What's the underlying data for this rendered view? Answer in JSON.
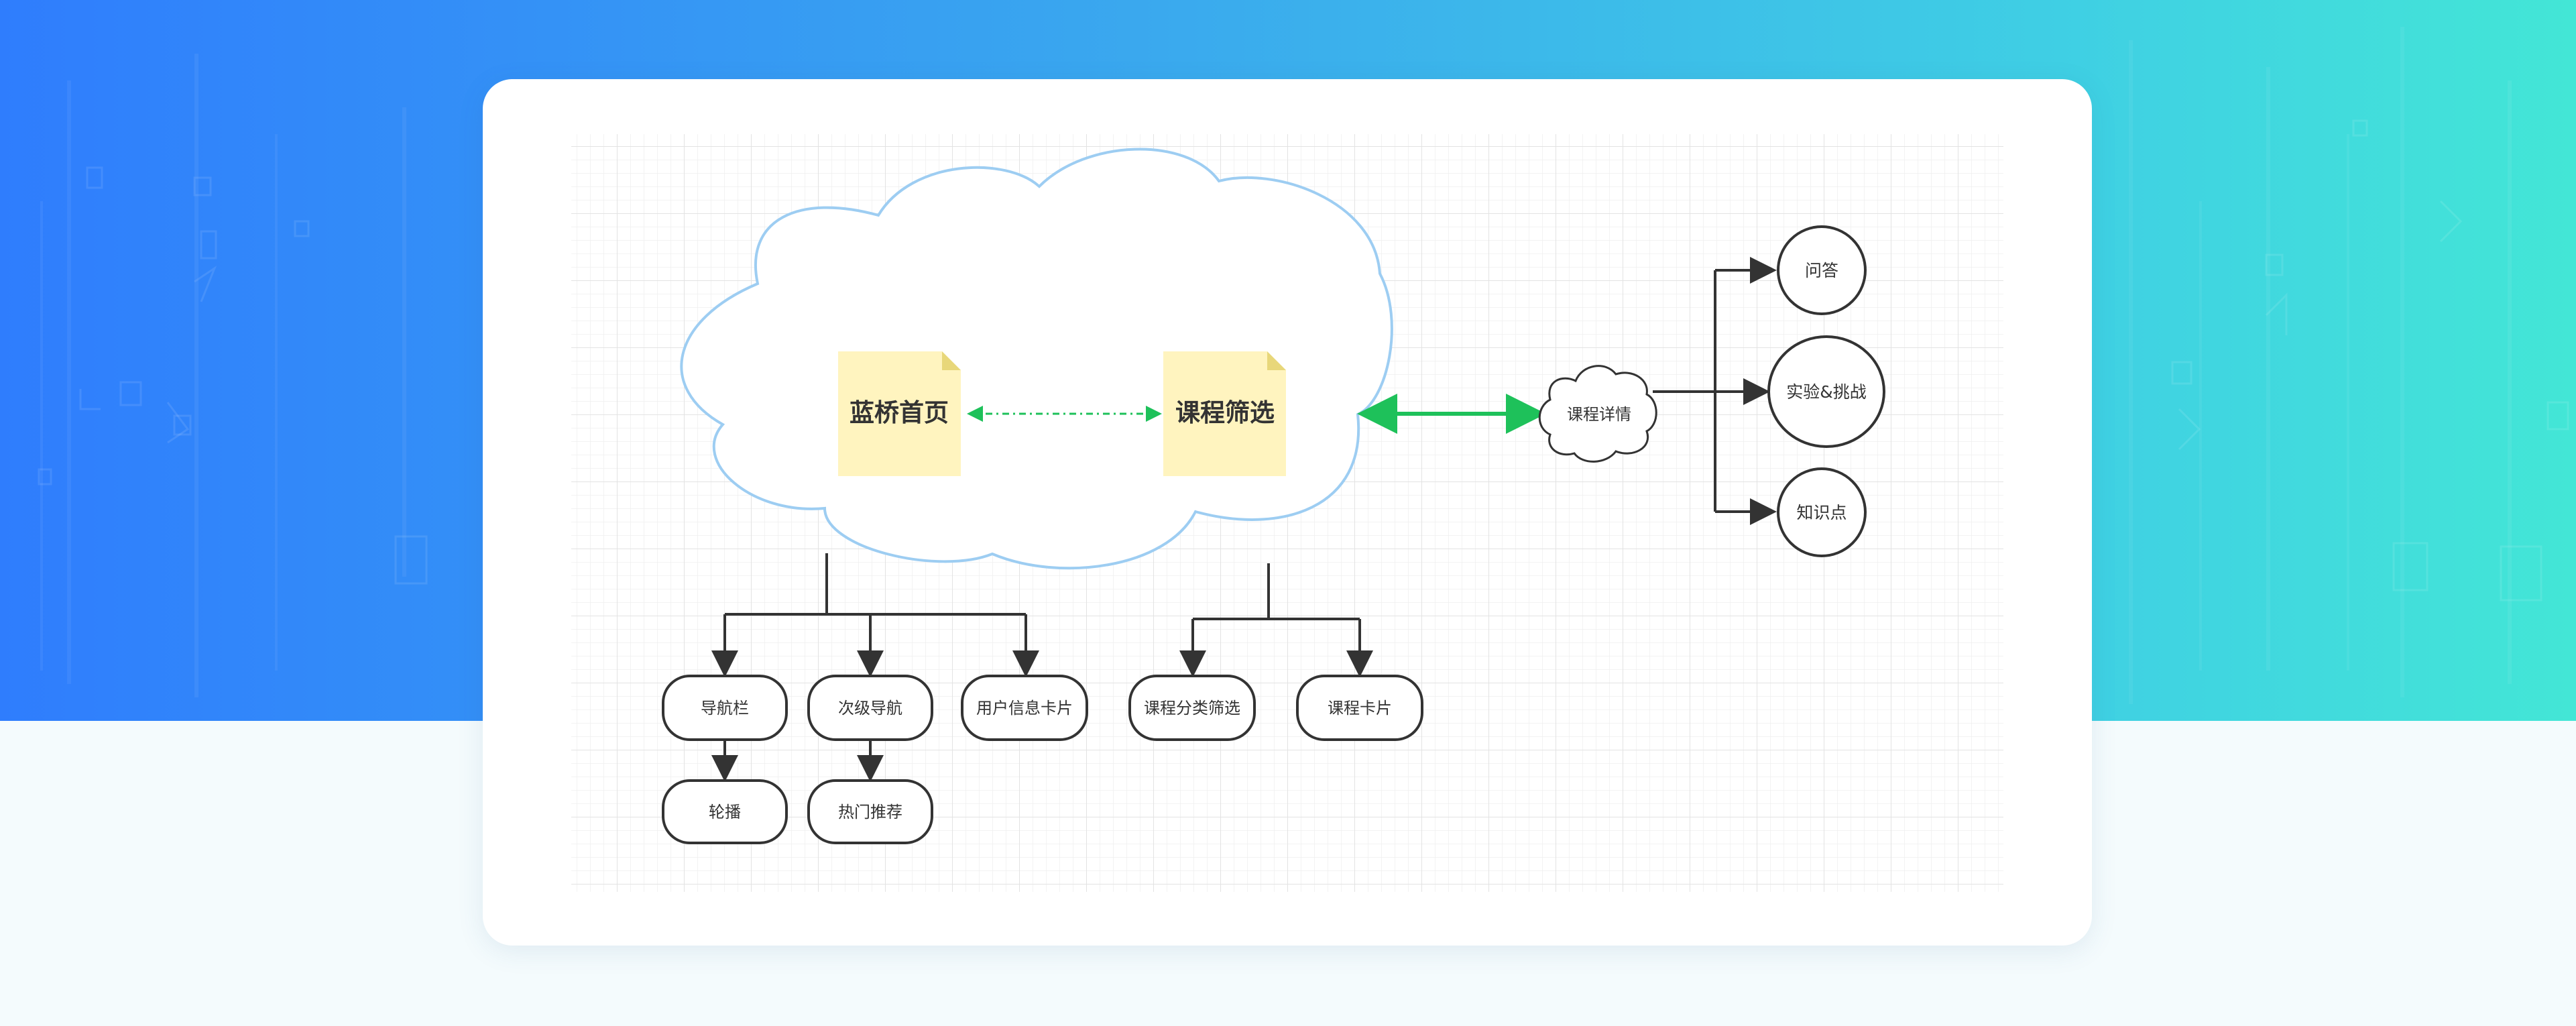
{
  "diagram": {
    "cloud_nodes": {
      "home": "蓝桥首页",
      "course_filter": "课程筛选"
    },
    "detail": "课程详情",
    "detail_children": [
      "问答",
      "实验&挑战",
      "知识点"
    ],
    "home_children": [
      "导航栏",
      "次级导航",
      "用户信息卡片"
    ],
    "home_grandchildren": [
      "轮播",
      "热门推荐"
    ],
    "filter_children": [
      "课程分类筛选",
      "课程卡片"
    ]
  },
  "colors": {
    "banner_start": "#2f7dfd",
    "banner_end": "#43e6d6",
    "note_fill": "#fff4bf",
    "note_fold": "#e8d77a",
    "cloud_stroke": "#9dcdf2",
    "link_green": "#1ec15a",
    "line_dark": "#333333"
  }
}
